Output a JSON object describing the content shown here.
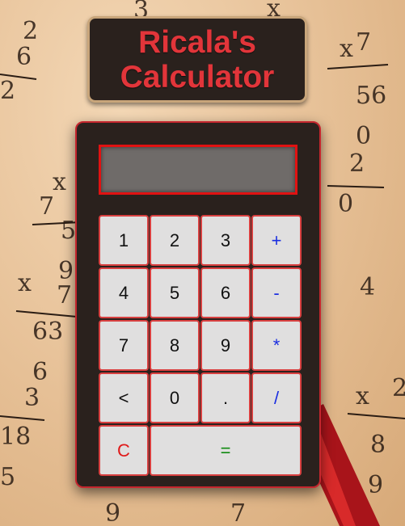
{
  "title": {
    "line1": "Ricala's",
    "line2": "Calculator"
  },
  "display": {
    "value": ""
  },
  "keys": [
    {
      "label": "1",
      "type": "digit"
    },
    {
      "label": "2",
      "type": "digit"
    },
    {
      "label": "3",
      "type": "digit"
    },
    {
      "label": "+",
      "type": "op"
    },
    {
      "label": "4",
      "type": "digit"
    },
    {
      "label": "5",
      "type": "digit"
    },
    {
      "label": "6",
      "type": "digit"
    },
    {
      "label": "-",
      "type": "op"
    },
    {
      "label": "7",
      "type": "digit"
    },
    {
      "label": "8",
      "type": "digit"
    },
    {
      "label": "9",
      "type": "digit"
    },
    {
      "label": "*",
      "type": "op"
    },
    {
      "label": "<",
      "type": "digit"
    },
    {
      "label": "0",
      "type": "digit"
    },
    {
      "label": ".",
      "type": "digit"
    },
    {
      "label": "/",
      "type": "op"
    },
    {
      "label": "C",
      "type": "clear"
    },
    {
      "label": "=",
      "type": "equals"
    }
  ],
  "colors": {
    "title_text": "#e2353a",
    "panel": "#2a211d",
    "panel_border": "#c5262e",
    "display_bg": "#6f6b69",
    "display_border": "#e01212",
    "key_bg": "#e0dfdf",
    "key_border": "#d84040",
    "operator_text": "#1a2ee0",
    "clear_text": "#e01a1a",
    "equals_text": "#108a10"
  }
}
